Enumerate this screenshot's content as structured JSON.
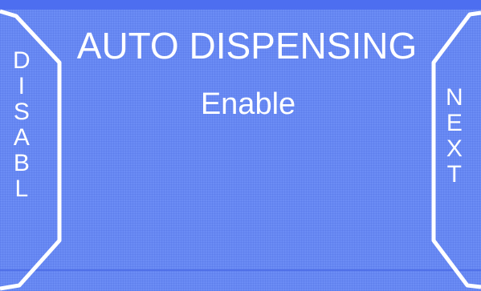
{
  "screen": {
    "title": "AUTO DISPENSING",
    "status": "Enable"
  },
  "left_button": {
    "label_letters": [
      "D",
      "I",
      "S",
      "A",
      "B",
      "L"
    ]
  },
  "right_button": {
    "label_letters": [
      "N",
      "E",
      "X",
      "T"
    ]
  },
  "colors": {
    "background": "#6b8cf5",
    "frame": "#ffffff",
    "text": "#ffffff"
  }
}
